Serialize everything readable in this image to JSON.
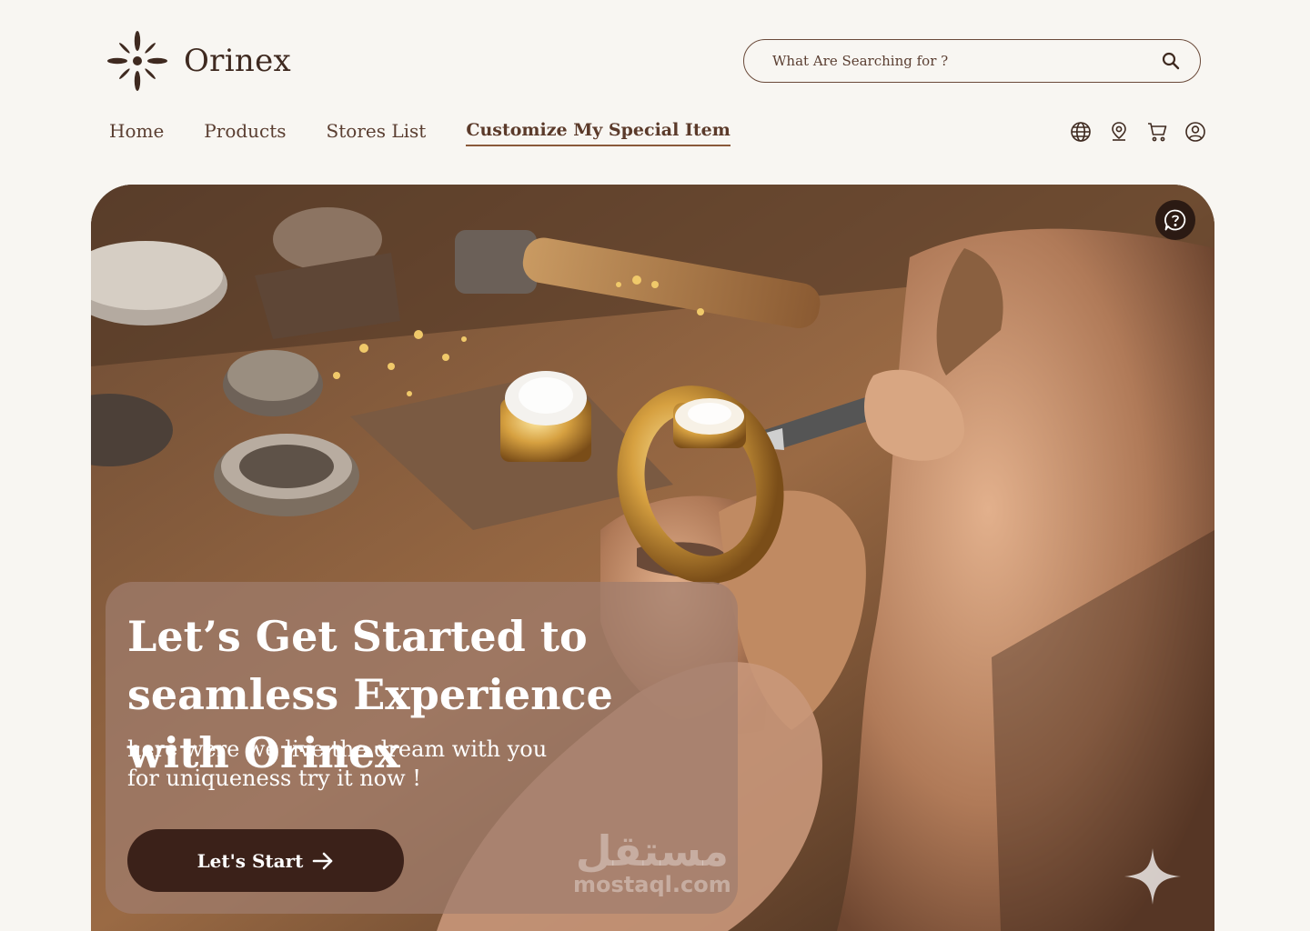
{
  "brand": {
    "name": "Orinex",
    "logo_icon": "starburst-logo-icon"
  },
  "search": {
    "placeholder": "What Are Searching for ?",
    "icon": "search-icon"
  },
  "nav": {
    "items": [
      {
        "label": "Home",
        "active": false
      },
      {
        "label": "Products",
        "active": false
      },
      {
        "label": "Stores List",
        "active": false
      },
      {
        "label": "Customize My Special Item",
        "active": true
      }
    ]
  },
  "header_icons": [
    "globe-icon",
    "location-pin-icon",
    "cart-icon",
    "user-icon"
  ],
  "hero": {
    "title": "Let’s Get Started to seamless Experience with Orinex",
    "subtitle_line1": "here were we live the dream with you",
    "subtitle_line2": "for uniqueness try it now !",
    "cta_label": "Let's Start",
    "help_icon": "help-question-icon",
    "watermark_ar": "مستقل",
    "watermark_en": "mostaql.com"
  },
  "colors": {
    "background": "#f8f6f2",
    "brand_dark": "#3b2119",
    "text_brown": "#5a3e31",
    "card_overlay": "#a07d6e"
  }
}
